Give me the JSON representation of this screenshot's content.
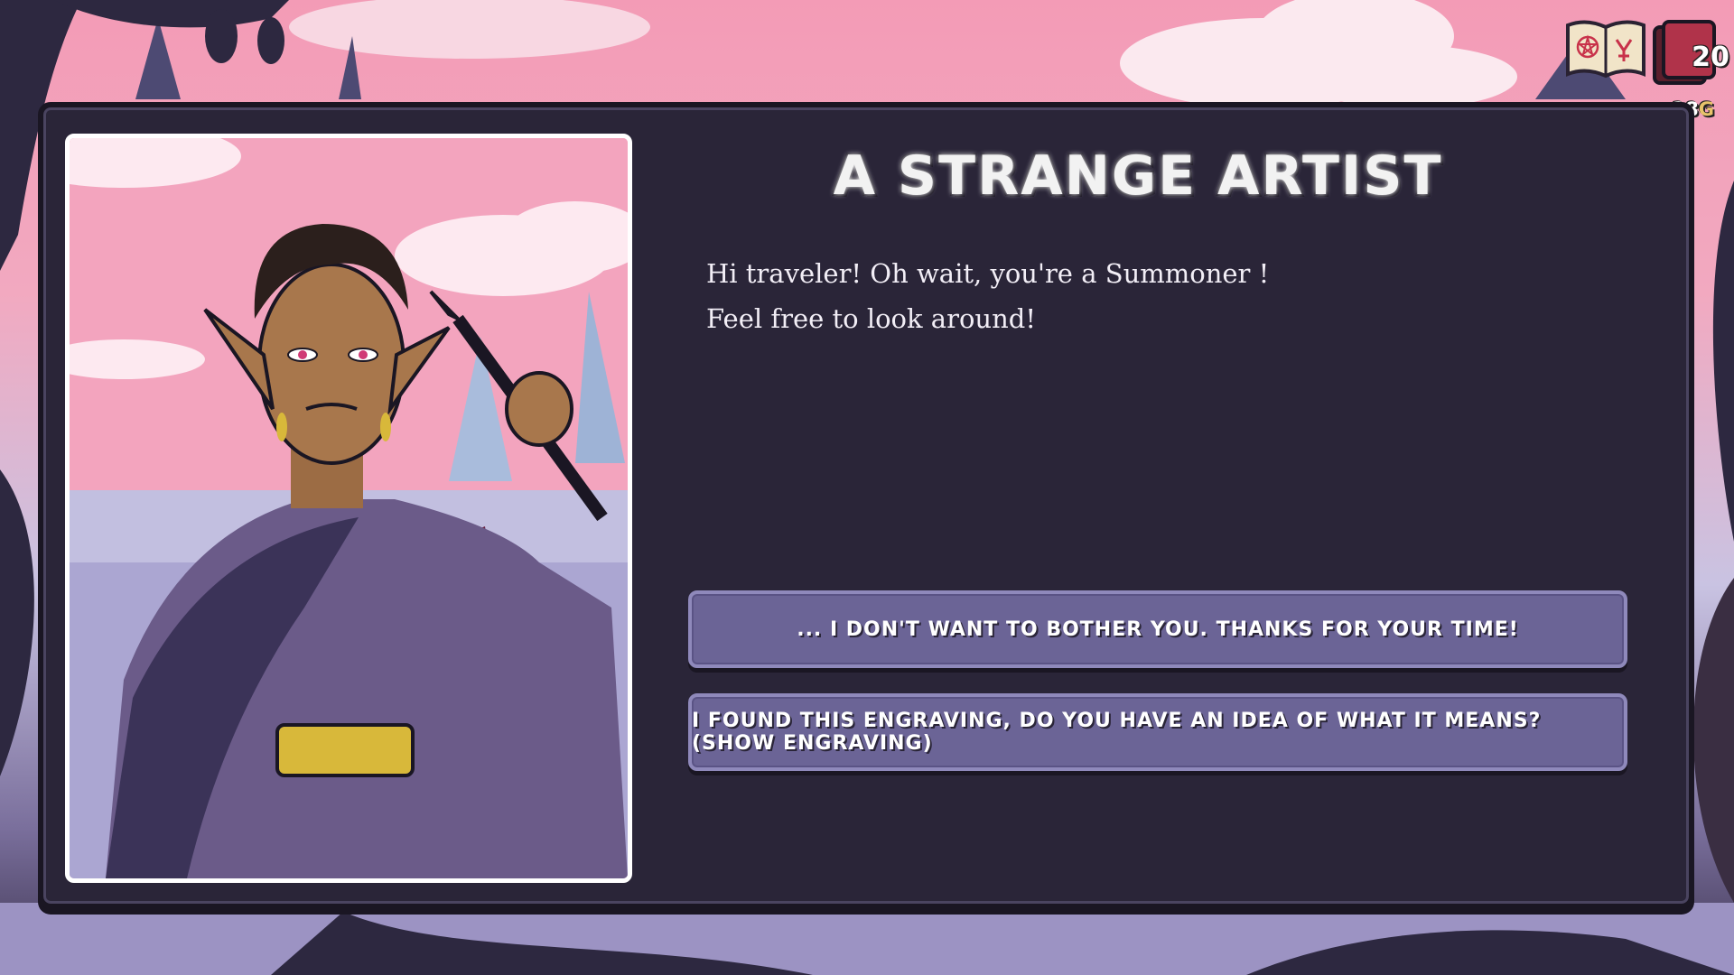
{
  "hud": {
    "book_icon": "spellbook-icon",
    "deck_icon": "card-deck-icon",
    "deck_count": "20",
    "gold_amount": "28",
    "gold_unit": "G"
  },
  "event": {
    "title": "A STRANGE ARTIST",
    "dialogue": [
      "Hi traveler! Oh wait, you're a Summoner !",
      "Feel free to look around!"
    ],
    "portrait_subject": "elf-painter-portrait"
  },
  "choices": [
    {
      "label": "... I DON'T WANT TO BOTHER YOU. THANKS FOR YOUR TIME!"
    },
    {
      "label": "I FOUND THIS ENGRAVING, DO YOU HAVE AN IDEA OF WHAT IT MEANS? (SHOW ENGRAVING)"
    }
  ],
  "colors": {
    "panel_bg": "#2a2538",
    "choice_bg": "#6b6496",
    "sky_pink": "#f39bb6"
  }
}
